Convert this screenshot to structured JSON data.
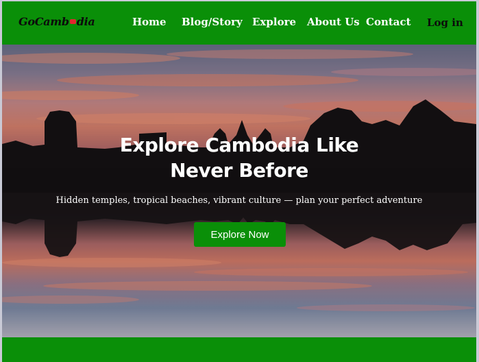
{
  "brand": {
    "logo_text_a": "GoCamb",
    "logo_text_b": "dia",
    "flag_color": "#e3262f"
  },
  "nav": {
    "items": [
      {
        "label": "Home"
      },
      {
        "label": "Blog/Story"
      },
      {
        "label": "Explore"
      },
      {
        "label": "About Us"
      },
      {
        "label": "Contact"
      }
    ],
    "login_label": "Log in"
  },
  "hero": {
    "title_line1": "Explore Cambodia Like",
    "title_line2": "Never Before",
    "subtitle": "Hidden temples, tropical beaches, vibrant culture — plan your perfect adventure",
    "cta_label": "Explore Now"
  },
  "colors": {
    "brand_green": "#0a8f08",
    "text_white": "#ffffff",
    "text_dark": "#0b0b0b"
  }
}
